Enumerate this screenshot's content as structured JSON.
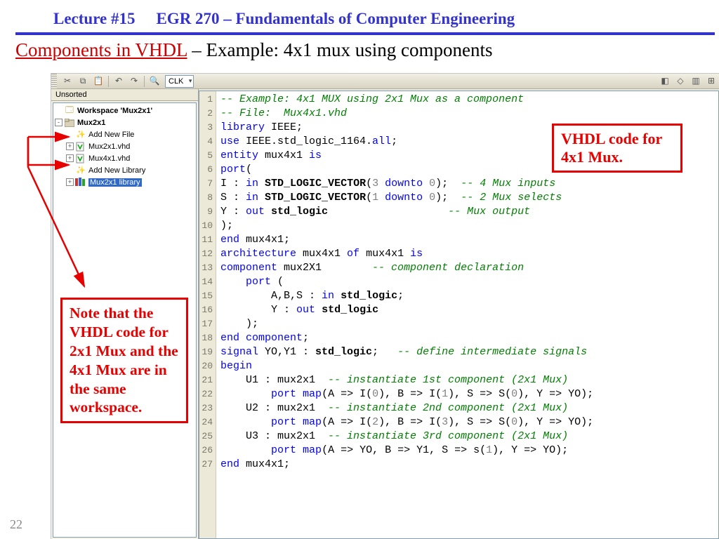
{
  "header": {
    "lecture": "Lecture #15",
    "course": "EGR 270 – Fundamentals of Computer Engineering"
  },
  "subtitle": {
    "link": "Components in VHDL",
    "rest": " – Example:  4x1 mux using components"
  },
  "page_number": "22",
  "callouts": {
    "right": "VHDL code for 4x1 Mux.",
    "left": "Note that the VHDL code for 2x1 Mux and the 4x1 Mux are in the same workspace."
  },
  "sidebar": {
    "tab": "Unsorted",
    "rows": [
      {
        "indent": 0,
        "tw": "",
        "icon": "ws",
        "label": "Workspace 'Mux2x1'",
        "bold": true
      },
      {
        "indent": 0,
        "tw": "-",
        "icon": "proj",
        "label": "Mux2x1",
        "bold": true
      },
      {
        "indent": 1,
        "tw": "",
        "icon": "wand",
        "label": "Add New File"
      },
      {
        "indent": 1,
        "tw": "+",
        "icon": "file",
        "label": "Mux2x1.vhd"
      },
      {
        "indent": 1,
        "tw": "+",
        "icon": "file",
        "label": "Mux4x1.vhd"
      },
      {
        "indent": 1,
        "tw": "",
        "icon": "wand",
        "label": "Add New Library"
      },
      {
        "indent": 1,
        "tw": "+",
        "icon": "lib",
        "label": "Mux2x1 library",
        "selected": true
      }
    ]
  },
  "toolbar": {
    "combo": "CLK"
  },
  "code_plain": "-- Example: 4x1 MUX using 2x1 Mux as a component\n-- File:  Mux4x1.vhd\nlibrary IEEE;\nuse IEEE.std_logic_1164.all;\nentity mux4x1 is\nport(\nI : in STD_LOGIC_VECTOR(3 downto 0); -- 4 Mux inputs\nS : in STD_LOGIC_VECTOR(1 downto 0); -- 2 Mux selects\nY : out std_logic                    -- Mux output\n);\nend mux4x1;\narchitecture mux4x1 of mux4x1 is\ncomponent mux2X1        -- component declaration\n    port (\n        A,B,S : in std_logic;\n        Y : out std_logic\n    );\nend component;\nsignal YO,Y1 : std_logic;   -- define intermediate signals\nbegin\n    U1 : mux2x1  -- instantiate 1st component (2x1 Mux)\n        port map(A => I(0), B => I(1), S => S(0), Y => YO);\n    U2 : mux2x1  -- instantiate 2nd component (2x1 Mux)\n        port map(A => I(2), B => I(3), S => S(0), Y => YO);\n    U3 : mux2x1  -- instantiate 3rd component (2x1 Mux)\n        port map(A => YO, B => Y1, S => s(1), Y => YO);\nend mux4x1;",
  "code_html_lines": [
    "<span class='cm'>-- Example: 4x1 MUX using 2x1 Mux as a component</span>",
    "<span class='cm'>-- File:  Mux4x1.vhd</span>",
    "<span class='kw'>library</span> IEEE;",
    "<span class='kw'>use</span> IEEE.std_logic_1164.<span class='kw'>all</span>;",
    "<span class='kw'>entity</span> mux4x1 <span class='kw'>is</span>",
    "<span class='kw'>port</span>(",
    "I : <span class='kw'>in</span> <span class='bld'>STD_LOGIC_VECTOR</span>(<span class='gray'>3</span> <span class='kw'>downto</span> <span class='gray'>0</span>);  <span class='cm'>-- 4 Mux inputs</span>",
    "S : <span class='kw'>in</span> <span class='bld'>STD_LOGIC_VECTOR</span>(<span class='gray'>1</span> <span class='kw'>downto</span> <span class='gray'>0</span>);  <span class='cm'>-- 2 Mux selects</span>",
    "Y : <span class='kw'>out</span> <span class='bld'>std_logic</span>                   <span class='cm'>-- Mux output</span>",
    ");",
    "<span class='kw'>end</span> mux4x1;",
    "<span class='kw'>architecture</span> mux4x1 <span class='kw'>of</span> mux4x1 <span class='kw'>is</span>",
    "<span class='kw'>component</span> mux2X1        <span class='cm'>-- component declaration</span>",
    "    <span class='kw'>port</span> (",
    "        A,B,S : <span class='kw'>in</span> <span class='bld'>std_logic</span>;",
    "        Y : <span class='kw'>out</span> <span class='bld'>std_logic</span>",
    "    );",
    "<span class='kw'>end</span> <span class='kw'>component</span>;",
    "<span class='kw'>signal</span> YO,Y1 : <span class='bld'>std_logic</span>;   <span class='cm'>-- define intermediate signals</span>",
    "<span class='kw'>begin</span>",
    "    U1 : mux2x1  <span class='cm'>-- instantiate 1st component (2x1 Mux)</span>",
    "        <span class='kw'>port</span> <span class='kw'>map</span>(A =&gt; I(<span class='gray'>0</span>), B =&gt; I(<span class='gray'>1</span>), S =&gt; S(<span class='gray'>0</span>), Y =&gt; YO);",
    "    U2 : mux2x1  <span class='cm'>-- instantiate 2nd component (2x1 Mux)</span>",
    "        <span class='kw'>port</span> <span class='kw'>map</span>(A =&gt; I(<span class='gray'>2</span>), B =&gt; I(<span class='gray'>3</span>), S =&gt; S(<span class='gray'>0</span>), Y =&gt; YO);",
    "    U3 : mux2x1  <span class='cm'>-- instantiate 3rd component (2x1 Mux)</span>",
    "        <span class='kw'>port</span> <span class='kw'>map</span>(A =&gt; YO, B =&gt; Y1, S =&gt; s(<span class='gray'>1</span>), Y =&gt; YO);",
    "<span class='kw'>end</span> mux4x1;"
  ]
}
